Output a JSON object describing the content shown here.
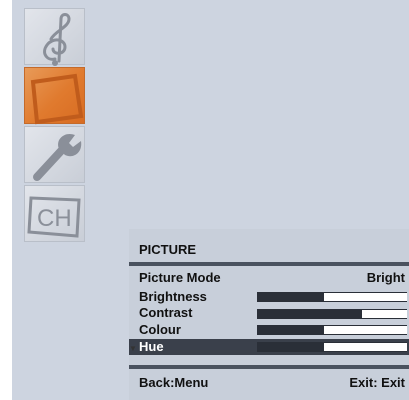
{
  "menu_icons": [
    {
      "name": "sound-menu-icon",
      "active": false
    },
    {
      "name": "picture-menu-icon",
      "active": true
    },
    {
      "name": "setup-menu-icon",
      "active": false
    },
    {
      "name": "channel-menu-icon",
      "active": false,
      "label": "CH"
    }
  ],
  "panel": {
    "title": "PICTURE",
    "picture_mode": {
      "label": "Picture Mode",
      "value": "Bright"
    },
    "sliders": [
      {
        "label": "Brightness",
        "level": 0.55
      },
      {
        "label": "Contrast",
        "level": 0.3
      },
      {
        "label": "Colour",
        "level": 0.55
      },
      {
        "label": "Hue",
        "level": 0.55,
        "selected": true
      }
    ],
    "footer": {
      "back": "Back:Menu",
      "exit": "Exit: Exit"
    }
  },
  "colors": {
    "background": "#cdd4e0",
    "active_icon": "#e07a2e",
    "bar_track": "#2a2f38",
    "bar_fill": "#ffffff",
    "divider": "#4a525f"
  }
}
